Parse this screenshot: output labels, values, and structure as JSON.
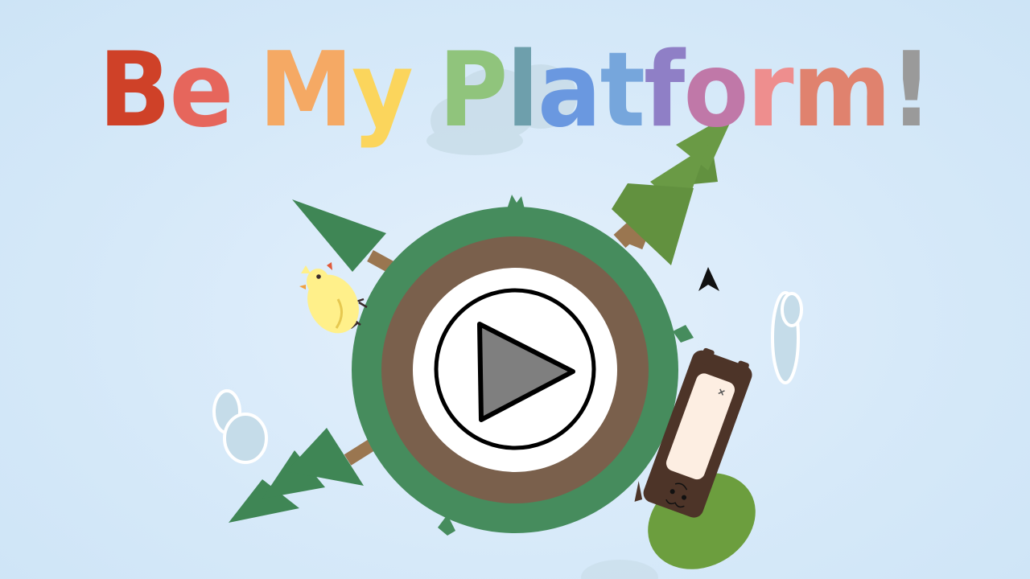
{
  "title": {
    "letters": [
      {
        "ch": "B",
        "color": "#cf4128"
      },
      {
        "ch": "e",
        "color": "#e6665c"
      },
      {
        "ch": " ",
        "color": "#000000"
      },
      {
        "ch": "M",
        "color": "#f5a964"
      },
      {
        "ch": "y",
        "color": "#fbd55c"
      },
      {
        "ch": " ",
        "color": "#000000"
      },
      {
        "ch": "P",
        "color": "#90c47c"
      },
      {
        "ch": "l",
        "color": "#6e9fac"
      },
      {
        "ch": "a",
        "color": "#6a98e0"
      },
      {
        "ch": "t",
        "color": "#76a6dc"
      },
      {
        "ch": "f",
        "color": "#8f7fc6"
      },
      {
        "ch": "o",
        "color": "#c078a8"
      },
      {
        "ch": "r",
        "color": "#ee8e8e"
      },
      {
        "ch": "m",
        "color": "#e0826e"
      },
      {
        "ch": "!",
        "color": "#9a9a9a"
      }
    ]
  },
  "play_button": {
    "icon": "play-icon",
    "fill": "#7f7f7f"
  },
  "colors": {
    "grass": "#468c5d",
    "dirt": "#7a604c",
    "core": "#ffffff",
    "tree_dark": "#3f8655",
    "tree_olive": "#62913f",
    "trunk": "#9a7650",
    "chick": "#fff08a",
    "phone": "#4d3428",
    "phone_screen": "#fdeee2",
    "bush": "#6c9e3e",
    "cloud": "#c5dce9"
  }
}
